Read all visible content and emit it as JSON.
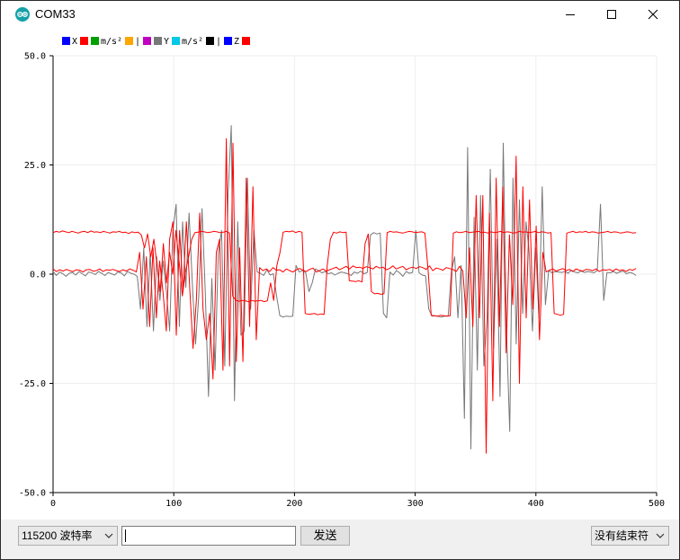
{
  "window": {
    "title": "COM33"
  },
  "toolbar": {
    "baud_label": "115200 波特率",
    "send_label": "发送",
    "send_value": "",
    "line_ending_label": "没有结束符"
  },
  "chart_data": {
    "type": "line",
    "xlim": [
      0,
      500
    ],
    "ylim": [
      -50,
      50
    ],
    "x_ticks": [
      "0",
      "100",
      "200",
      "300",
      "400",
      "500"
    ],
    "y_ticks": [
      "50.0",
      "25.0",
      "0.0",
      "-25.0",
      "-50.0"
    ],
    "grid": true,
    "legend_position": "top-left",
    "legend": [
      {
        "label": "X",
        "color": "#0000ff"
      },
      {
        "label": "",
        "color": "#ff0000"
      },
      {
        "label": "m/s²",
        "color": "#00a000"
      },
      {
        "label": "|",
        "color": "#ffa500"
      },
      {
        "label": "",
        "color": "#c000c0"
      },
      {
        "label": "Y",
        "color": "#777777"
      },
      {
        "label": "m/s²",
        "color": "#00c8e6"
      },
      {
        "label": "|",
        "color": "#000000"
      },
      {
        "label": "Z",
        "color": "#0000ff"
      },
      {
        "label": "",
        "color": "#ff0000"
      }
    ],
    "series": [
      {
        "color": "#777777",
        "values": [
          0.6,
          -0.3,
          0.5,
          0.1,
          -0.5,
          0.2,
          0.4,
          -0.2,
          0.6,
          0.1,
          -0.4,
          0.5,
          0.3,
          -0.1,
          0.6,
          0.2,
          -0.3,
          0.4,
          0.1,
          -0.2,
          0.5,
          0.3,
          -0.4,
          0.6,
          0.2,
          0.0,
          -0.5,
          -8.0,
          6.0,
          -12.0,
          5.0,
          -13.0,
          4.0,
          -6.0,
          3.0,
          -4.0,
          -13.0,
          10.0,
          16.0,
          -12.0,
          12.0,
          -3.0,
          14.0,
          -2.0,
          -16.0,
          -5.0,
          15.0,
          -4.0,
          -28.0,
          -1.0,
          -22.0,
          5.0,
          10.0,
          -21.0,
          18.0,
          34.0,
          -29.0,
          12.0,
          -14.0,
          -13.0,
          22.0,
          -8.0,
          10.0,
          0.5,
          0.2,
          -0.3,
          1.0,
          -0.2,
          0.1,
          -5.0,
          -9.5,
          -9.8,
          -9.6,
          -9.7,
          -9.6,
          2.0,
          0.5,
          0.8,
          0.3,
          -4.0,
          -2.0,
          1.2,
          0.8,
          0.3,
          0.6,
          0.1,
          0.3,
          -0.2,
          0.2,
          0.5,
          0.3,
          0.1,
          -0.3,
          0.5,
          0.2,
          0.7,
          0.1,
          0.4,
          9.0,
          9.5,
          9.2,
          9.4,
          -9.0,
          -10.0,
          0.5,
          -0.2,
          0.8,
          0.3,
          -0.5,
          0.6,
          0.2,
          0.4,
          10.0,
          0.3,
          -0.2,
          -0.4,
          -8.0,
          -9.6,
          -9.5,
          -9.7,
          -9.8,
          -9.6,
          -9.5,
          0.8,
          4.0,
          -10.0,
          2.0,
          -33.0,
          29.0,
          -40.0,
          13.0,
          -22.0,
          18.0,
          -21.0,
          -10.0,
          24.0,
          -17.0,
          8.0,
          -28.0,
          30.0,
          -13.0,
          -36.0,
          22.0,
          -16.0,
          17.0,
          -9.0,
          12.0,
          5.0,
          -13.0,
          6.0,
          -10.0,
          20.0,
          -7.0,
          0.8,
          0.3,
          0.6,
          0.5,
          0.4,
          0.6,
          0.2,
          0.9,
          0.5,
          0.3,
          0.7,
          0.4,
          0.6,
          0.5,
          0.3,
          0.8,
          16.0,
          -6.0,
          0.4,
          0.3,
          0.6,
          0.2,
          0.5,
          0.7,
          0.1,
          0.4,
          0.2,
          -0.3
        ]
      },
      {
        "color": "#ff0000",
        "values": [
          1.2,
          0.6,
          1.0,
          0.7,
          1.1,
          0.8,
          0.6,
          1.0,
          0.9,
          0.5,
          1.0,
          1.1,
          0.7,
          0.8,
          1.2,
          0.6,
          1.0,
          0.9,
          1.1,
          0.8,
          0.6,
          1.0,
          0.7,
          1.2,
          0.9,
          0.5,
          5.0,
          -8.0,
          4.0,
          -12.0,
          6.0,
          -10.0,
          3.0,
          -4.0,
          -13.0,
          8.0,
          12.0,
          -14.0,
          10.0,
          -4.0,
          12.0,
          -3.0,
          -17.0,
          -6.0,
          14.0,
          -8.0,
          -15.0,
          -9.0,
          -24.0,
          5.0,
          8.0,
          -22.0,
          31.0,
          -21.0,
          30.0,
          -20.0,
          6.0,
          -20.0,
          22.0,
          -12.0,
          20.0,
          -15.0,
          1.5,
          0.8,
          1.2,
          0.6,
          1.5,
          0.9,
          1.0,
          0.5,
          1.2,
          0.8,
          0.5,
          1.0,
          1.3,
          0.9,
          0.6,
          1.1,
          1.4,
          0.5,
          0.8,
          1.2,
          0.7,
          1.0,
          1.3,
          1.6,
          1.0,
          1.4,
          1.8,
          1.2,
          1.9,
          1.5,
          1.6,
          1.3,
          1.7,
          1.5,
          1.2,
          1.8,
          1.4,
          1.6,
          1.0,
          1.3,
          1.9,
          1.2,
          1.5,
          1.8,
          1.0,
          1.4,
          1.6,
          1.3,
          1.7,
          1.5,
          1.1,
          1.9,
          0.8,
          1.4,
          1.2,
          0.9,
          1.5,
          1.3,
          1.1,
          0.6,
          1.8,
          0.7,
          -10.0,
          6.0,
          -12.0,
          18.0,
          -10.0,
          18.0,
          -41.0,
          14.0,
          -29.0,
          22.0,
          -12.0,
          20.0,
          -18.0,
          9.0,
          -7.0,
          27.0,
          -25.0,
          20.0,
          -10.0,
          17.0,
          -8.0,
          11.0,
          -15.0,
          5.0,
          0.5,
          0.9,
          1.2,
          0.7,
          1.0,
          1.3,
          0.8,
          1.1,
          0.6,
          1.2,
          0.9,
          0.7,
          1.1,
          1.0,
          0.8,
          1.2,
          0.6,
          1.0,
          0.9,
          1.1,
          0.7,
          1.2,
          0.8,
          1.0,
          0.6,
          1.1,
          0.9,
          1.3
        ]
      },
      {
        "color": "#ff0000",
        "values": [
          9.5,
          9.8,
          9.6,
          9.9,
          9.7,
          9.5,
          9.8,
          9.6,
          9.4,
          9.7,
          9.8,
          9.5,
          9.9,
          9.6,
          9.7,
          9.5,
          9.8,
          9.6,
          9.4,
          9.7,
          9.6,
          9.8,
          9.5,
          9.6,
          9.3,
          9.7,
          9.5,
          9.6,
          9.0,
          6.0,
          9.2,
          4.0,
          8.0,
          2.0,
          -4.0,
          7.0,
          -2.0,
          5.0,
          0.0,
          10.0,
          3.0,
          -5.0,
          0.5,
          4.0,
          8.0,
          9.5,
          9.6,
          9.8,
          9.7,
          9.5,
          9.6,
          9.8,
          9.7,
          9.5,
          9.6,
          9.8,
          9.4,
          -5.0,
          -6.0,
          -6.2,
          -6.0,
          -6.1,
          -6.3,
          -6.0,
          -6.2,
          -6.1,
          -6.0,
          -6.3,
          -6.1,
          -2.0,
          -6.0,
          2.0,
          5.0,
          9.6,
          9.8,
          9.7,
          9.9,
          9.5,
          9.8,
          9.6,
          -9.0,
          -9.2,
          -9.1,
          -9.0,
          -9.3,
          -9.1,
          -9.2,
          2.0,
          8.0,
          9.6,
          9.4,
          9.7,
          9.5,
          9.6,
          -1.5,
          -1.6,
          -1.7,
          -1.5,
          -1.8,
          7.0,
          9.2,
          -4.0,
          -4.5,
          -4.4,
          -4.6,
          -4.5,
          9.5,
          9.8,
          9.6,
          9.7,
          9.5,
          9.4,
          9.6,
          9.8,
          9.7,
          9.5,
          9.6,
          9.7,
          9.4,
          1.0,
          -9.4,
          -9.5,
          -9.6,
          -9.4,
          -9.5,
          -9.6,
          -9.5,
          9.4,
          9.7,
          9.5,
          9.6,
          9.8,
          9.5,
          9.6,
          9.7,
          9.8,
          9.5,
          9.6,
          9.4,
          9.7,
          9.5,
          9.6,
          9.8,
          9.5,
          9.7,
          9.6,
          9.4,
          9.5,
          9.8,
          9.6,
          9.7,
          9.5,
          9.6,
          9.8,
          9.5,
          9.7,
          9.6,
          9.4,
          9.5,
          -9.0,
          -9.2,
          -9.4,
          -9.2,
          9.4,
          9.6,
          9.8,
          9.5,
          9.7,
          9.6,
          9.8,
          9.5,
          9.7,
          9.6,
          9.4,
          9.5,
          9.6,
          9.8,
          9.5,
          9.7,
          9.6,
          9.4,
          9.5,
          9.7,
          9.6,
          9.4,
          9.5
        ]
      }
    ]
  }
}
